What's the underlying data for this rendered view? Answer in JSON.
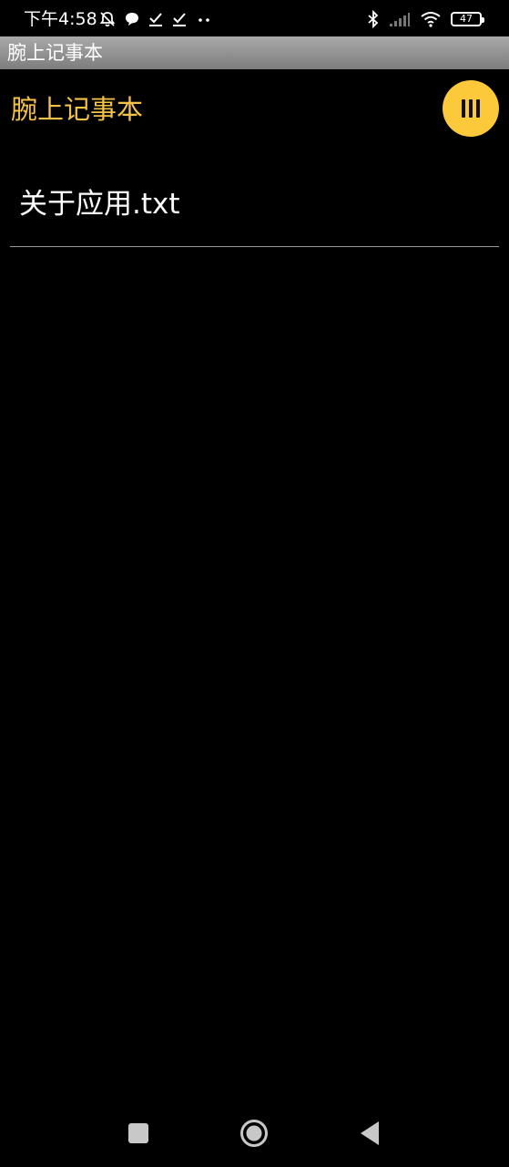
{
  "status_bar": {
    "time": "下午4:58",
    "battery": "47"
  },
  "title_bar": {
    "title": "腕上记事本"
  },
  "app_header": {
    "title": "腕上记事本",
    "menu_icon": "menu-bars-icon",
    "accent_color": "#f5c248",
    "menu_button_color": "#fbc93a"
  },
  "file_list": {
    "items": [
      {
        "name": "关于应用.txt"
      }
    ]
  },
  "nav_bar": {
    "recent_icon": "square-icon",
    "home_icon": "circle-icon",
    "back_icon": "triangle-back-icon"
  }
}
